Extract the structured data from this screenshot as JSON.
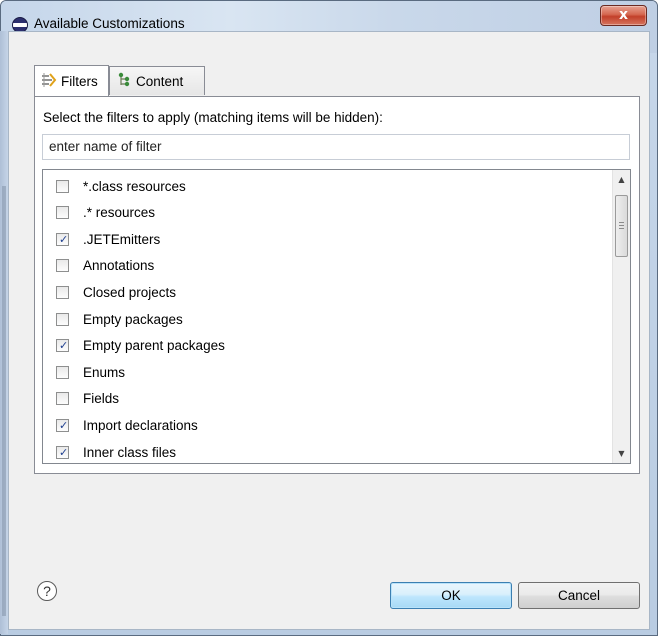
{
  "window": {
    "title": "Available Customizations",
    "close_label": "x"
  },
  "tabs": [
    {
      "label": "Filters",
      "selected": true,
      "icon": "filter-icon"
    },
    {
      "label": "Content",
      "selected": false,
      "icon": "tree-content-icon"
    }
  ],
  "filters": {
    "instruction": "Select the filters to apply (matching items will be hidden):",
    "input_value": "enter name of filter",
    "items": [
      {
        "label": "*.class resources",
        "checked": false
      },
      {
        "label": ".* resources",
        "checked": false
      },
      {
        "label": ".JETEmitters",
        "checked": true
      },
      {
        "label": "Annotations",
        "checked": false
      },
      {
        "label": "Closed projects",
        "checked": false
      },
      {
        "label": "Empty packages",
        "checked": false
      },
      {
        "label": "Empty parent packages",
        "checked": true
      },
      {
        "label": "Enums",
        "checked": false
      },
      {
        "label": "Fields",
        "checked": false
      },
      {
        "label": "Import declarations",
        "checked": true
      },
      {
        "label": "Inner class files",
        "checked": true
      }
    ]
  },
  "buttons": {
    "help": "?",
    "ok": "OK",
    "cancel": "Cancel"
  },
  "colors": {
    "title_gradient": "#c5d6ea",
    "close_button": "#c2402a",
    "ok_button": "#bee6fd",
    "checkmark": "#1f3f8f"
  }
}
